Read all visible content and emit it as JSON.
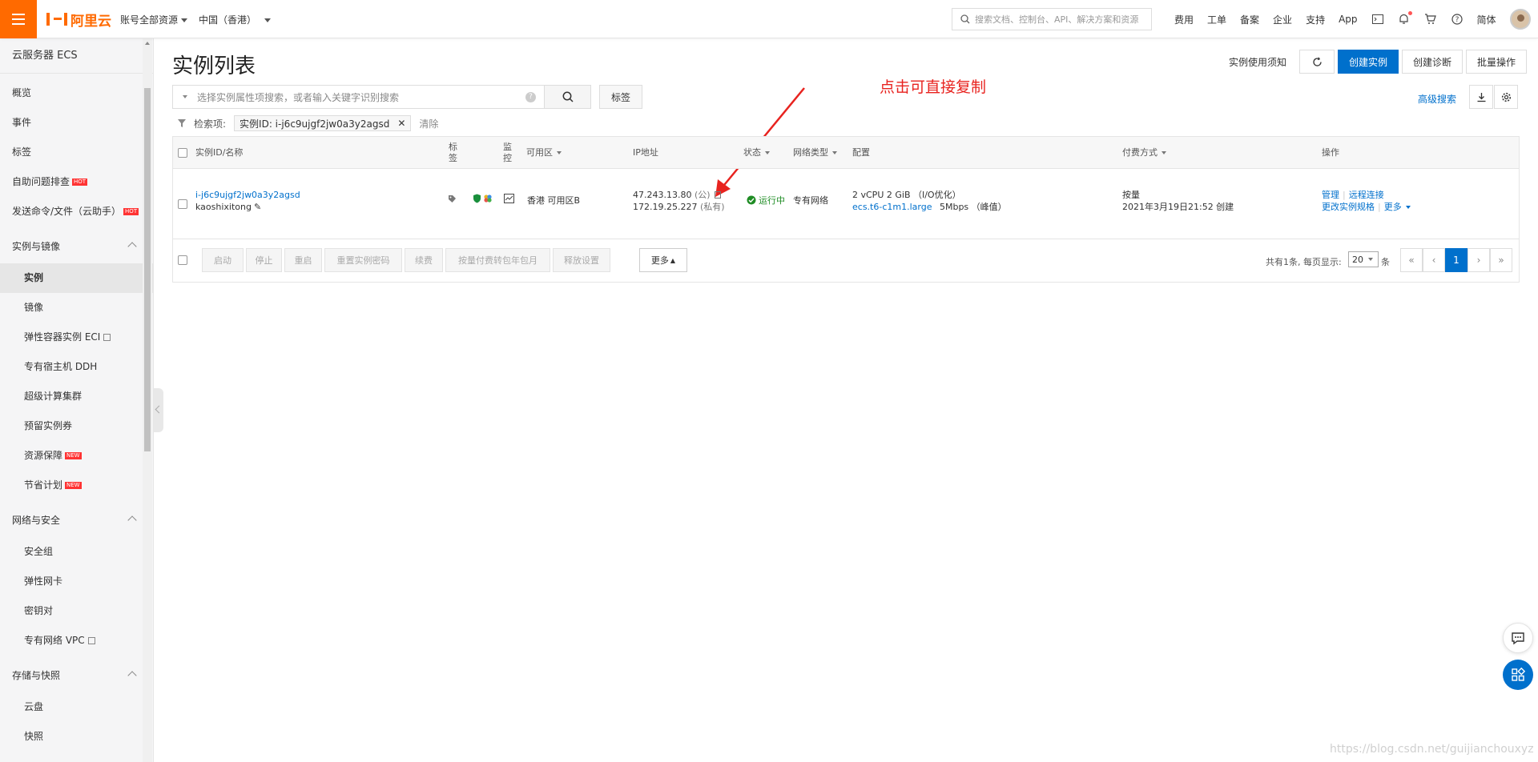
{
  "topbar": {
    "brand": "阿里云",
    "account_scope": "账号全部资源",
    "region": "中国（香港）",
    "search_placeholder": "搜索文档、控制台、API、解决方案和资源",
    "links": [
      "费用",
      "工单",
      "备案",
      "企业",
      "支持",
      "App"
    ],
    "language": "简体"
  },
  "sidebar": {
    "title": "云服务器 ECS",
    "top_items": [
      {
        "label": "概览"
      },
      {
        "label": "事件"
      },
      {
        "label": "标签"
      },
      {
        "label": "自助问题排查",
        "badge": "HOT"
      },
      {
        "label": "发送命令/文件（云助手）",
        "badge": "HOT"
      }
    ],
    "groups": [
      {
        "label": "实例与镜像",
        "items": [
          {
            "label": "实例",
            "active": true
          },
          {
            "label": "镜像"
          },
          {
            "label": "弹性容器实例 ECI",
            "external": true
          },
          {
            "label": "专有宿主机 DDH"
          },
          {
            "label": "超级计算集群"
          },
          {
            "label": "预留实例券"
          },
          {
            "label": "资源保障",
            "badge": "NEW"
          },
          {
            "label": "节省计划",
            "badge": "NEW"
          }
        ]
      },
      {
        "label": "网络与安全",
        "items": [
          {
            "label": "安全组"
          },
          {
            "label": "弹性网卡"
          },
          {
            "label": "密钥对"
          },
          {
            "label": "专有网络 VPC",
            "external": true
          }
        ]
      },
      {
        "label": "存储与快照",
        "items": [
          {
            "label": "云盘"
          },
          {
            "label": "快照"
          }
        ]
      }
    ]
  },
  "page": {
    "title": "实例列表",
    "usage_notice": "实例使用须知",
    "create_instance": "创建实例",
    "create_diagnosis": "创建诊断",
    "batch_ops": "批量操作",
    "search_placeholder": "选择实例属性项搜索，或者输入关键字识别搜索",
    "tag_button": "标签",
    "advanced_search": "高级搜索",
    "filter_label": "检索项:",
    "filter_chip": "实例ID: i-j6c9ujgf2jw0a3y2agsd",
    "clear": "清除",
    "annotation": "点击可直接复制"
  },
  "table": {
    "headers": {
      "id_name": "实例ID/名称",
      "tag": [
        "标",
        "签"
      ],
      "monitor": [
        "监",
        "控"
      ],
      "zone": "可用区",
      "ip": "IP地址",
      "status": "状态",
      "network_type": "网络类型",
      "config": "配置",
      "billing": "付费方式",
      "actions": "操作"
    },
    "rows": [
      {
        "instance_id": "i-j6c9ujgf2jw0a3y2agsd",
        "name": "kaoshixitong",
        "zone": "香港 可用区B",
        "public_ip": "47.243.13.80",
        "public_suffix": "(公)",
        "private_ip": "172.19.25.227",
        "private_suffix": "(私有)",
        "status": "运行中",
        "network_type": "专有网络",
        "config_spec": "2 vCPU 2 GiB （I/O优化）",
        "instance_type": "ecs.t6-c1m1.large",
        "bandwidth": "5Mbps （峰值）",
        "billing_type": "按量",
        "created": "2021年3月19日21:52 创建",
        "action_manage": "管理",
        "action_remote": "远程连接",
        "action_change_spec": "更改实例规格",
        "action_more": "更多"
      }
    ]
  },
  "footer_actions": [
    "启动",
    "停止",
    "重启",
    "重置实例密码",
    "续费",
    "按量付费转包年包月",
    "释放设置",
    "更多"
  ],
  "pagination": {
    "summary": "共有1条, 每页显示:",
    "page_size": "20",
    "unit": "条",
    "first": "«",
    "prev": "‹",
    "current": "1",
    "next": "›",
    "last": "»"
  },
  "watermark": "https://blog.csdn.net/guijianchouxyz",
  "colors": {
    "brand": "#ff6a00",
    "primary": "#0070cc",
    "annotation": "#e8231f",
    "running": "#1f8c24"
  }
}
